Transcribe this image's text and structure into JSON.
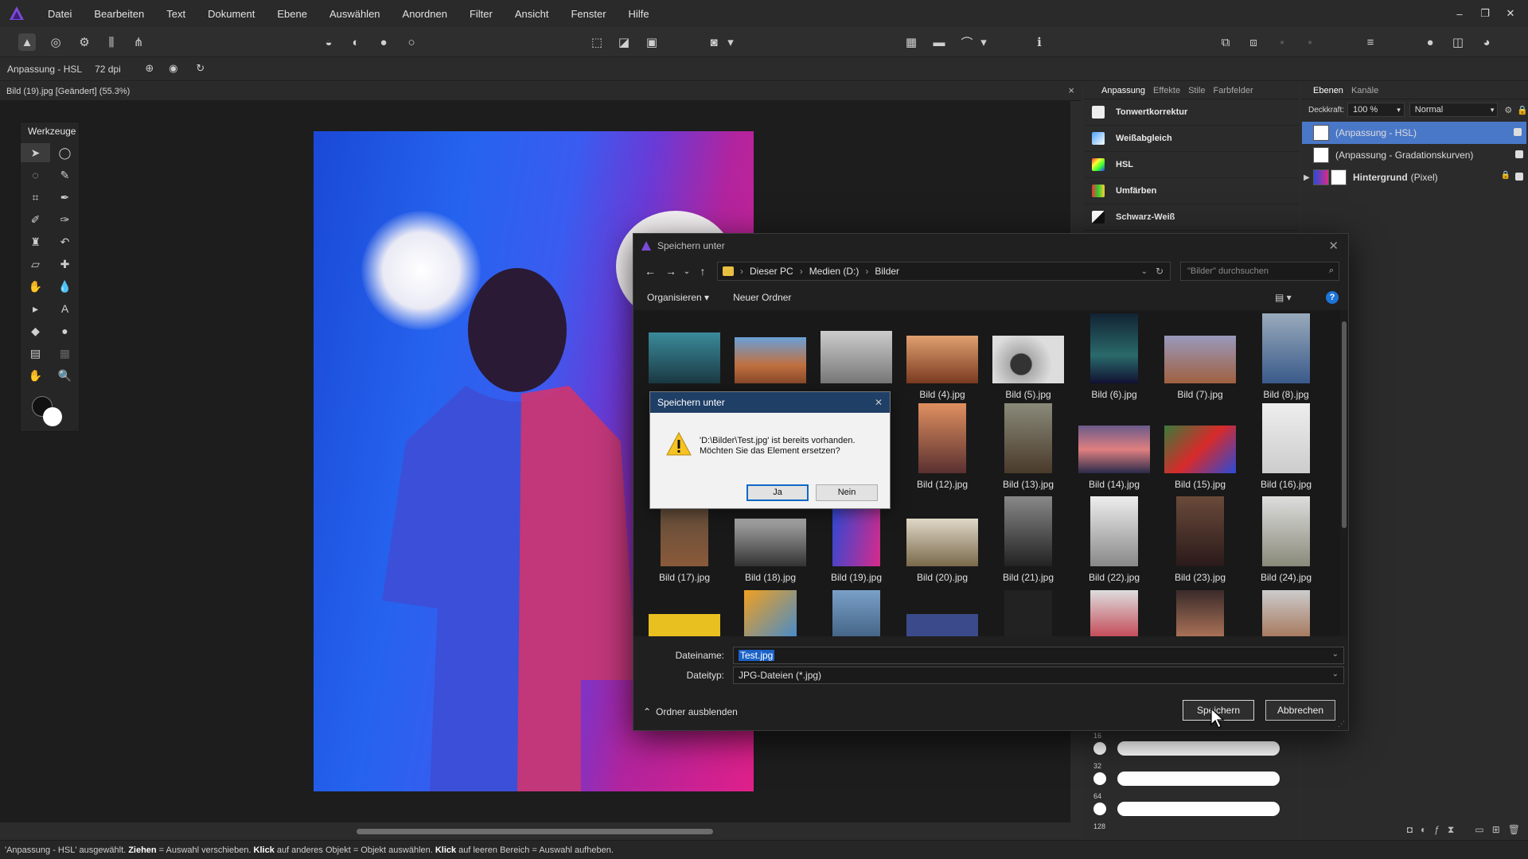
{
  "menubar": {
    "items": [
      "Datei",
      "Bearbeiten",
      "Text",
      "Dokument",
      "Ebene",
      "Auswählen",
      "Anordnen",
      "Filter",
      "Ansicht",
      "Fenster",
      "Hilfe"
    ],
    "win_min": "–",
    "win_restore": "❐",
    "win_close": "✕"
  },
  "context": {
    "tool_label": "Anpassung - HSL",
    "dpi": "72 dpi"
  },
  "document": {
    "tab_title": "Bild (19).jpg [Geändert] (55.3%)",
    "close": "×"
  },
  "tools": {
    "title": "Werkzeuge"
  },
  "adjustments": {
    "tabs": [
      "Anpassung",
      "Effekte",
      "Stile",
      "Farbfelder"
    ],
    "items": [
      "Tonwertkorrektur",
      "Weißabgleich",
      "HSL",
      "Umfärben",
      "Schwarz-Weiß"
    ]
  },
  "brushes": {
    "sizes": [
      "16",
      "32",
      "64",
      "128"
    ]
  },
  "layers": {
    "tabs": [
      "Ebenen",
      "Kanäle"
    ],
    "opacity_label": "Deckkraft:",
    "opacity_value": "100 %",
    "blend_mode": "Normal",
    "items": [
      {
        "name": "(Anpassung - HSL)",
        "selected": true
      },
      {
        "name": "(Anpassung - Gradationskurven)",
        "selected": false
      },
      {
        "name": "Hintergrund",
        "suffix": "(Pixel)",
        "selected": false
      }
    ]
  },
  "save_dialog": {
    "title": "Speichern unter",
    "close": "✕",
    "breadcrumb": [
      "Dieser PC",
      "Medien (D:)",
      "Bilder"
    ],
    "search_placeholder": "\"Bilder\" durchsuchen",
    "organize": "Organisieren ▾",
    "new_folder": "Neuer Ordner",
    "files_row1": [
      "",
      "",
      "",
      "Bild (4).jpg",
      "Bild (5).jpg",
      "Bild (6).jpg",
      "Bild (7).jpg",
      "Bild (8).jpg"
    ],
    "files_row2": [
      "Bild (12).jpg",
      "Bild (13).jpg",
      "Bild (14).jpg",
      "Bild (15).jpg",
      "Bild (16).jpg"
    ],
    "files_row3": [
      "Bild (17).jpg",
      "Bild (18).jpg",
      "Bild (19).jpg",
      "Bild (20).jpg",
      "Bild (21).jpg",
      "Bild (22).jpg",
      "Bild (23).jpg",
      "Bild (24).jpg"
    ],
    "filename_label": "Dateiname:",
    "filename_value": "Test.jpg",
    "filetype_label": "Dateityp:",
    "filetype_value": "JPG-Dateien (*.jpg)",
    "hide_folders": "Ordner ausblenden",
    "save": "Speichern",
    "cancel": "Abbrechen"
  },
  "confirm": {
    "title": "Speichern unter",
    "close": "✕",
    "line1": "'D:\\Bilder\\Test.jpg' ist bereits vorhanden.",
    "line2": "Möchten Sie das Element ersetzen?",
    "yes": "Ja",
    "no": "Nein"
  },
  "status": {
    "part1": "'Anpassung - HSL' ausgewählt.",
    "k1": "Ziehen",
    "t1": "= Auswahl verschieben.",
    "k2": "Klick",
    "t2": "auf anderes Objekt = Objekt auswählen.",
    "k3": "Klick",
    "t3": "auf leeren Bereich = Auswahl aufheben."
  },
  "colors": {
    "accent": "#3b6fd0",
    "selection": "#4a78c8",
    "dialog_title": "#1f3f66"
  }
}
